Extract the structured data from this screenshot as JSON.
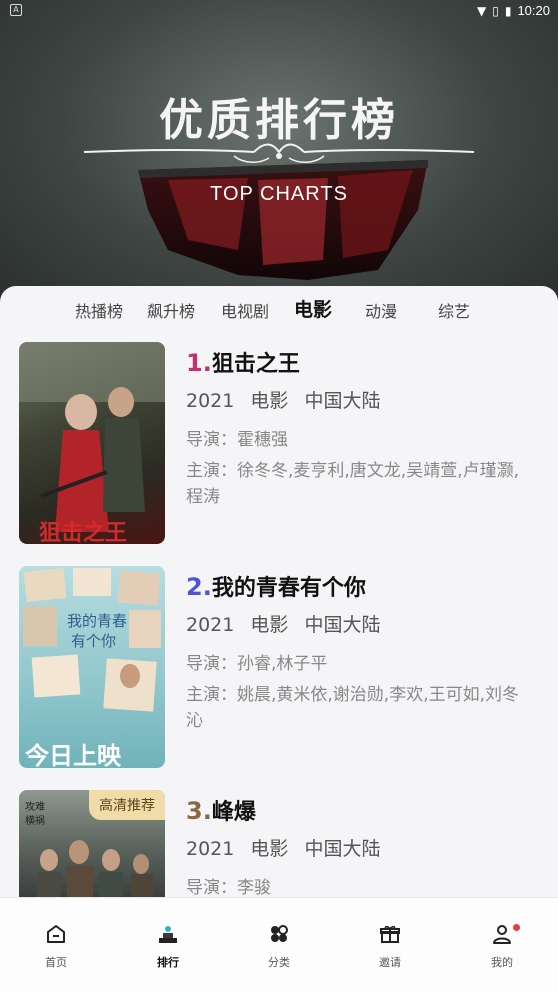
{
  "status_bar": {
    "time": "10:20"
  },
  "hero": {
    "title": "优质排行榜",
    "subtitle": "TOP CHARTS"
  },
  "tabs": [
    {
      "label": "热播榜",
      "active": false
    },
    {
      "label": "飙升榜",
      "active": false
    },
    {
      "label": "电视剧",
      "active": false
    },
    {
      "label": "电影",
      "active": true
    },
    {
      "label": "动漫",
      "active": false
    },
    {
      "label": "综艺",
      "active": false
    }
  ],
  "items": [
    {
      "rank": "1.",
      "rank_color": "#c2336e",
      "title": "狙击之王",
      "year": "2021",
      "type": "电影",
      "region": "中国大陆",
      "director": "导演：霍穗强",
      "cast": "主演：徐冬冬,麦亨利,唐文龙,吴靖萱,卢瑾灏,程涛",
      "poster_text": "狙击之王"
    },
    {
      "rank": "2.",
      "rank_color": "#4b55d6",
      "title": "我的青春有个你",
      "year": "2021",
      "type": "电影",
      "region": "中国大陆",
      "director": "导演：孙睿,林子平",
      "cast": "主演：姚晨,黄米依,谢治勋,李欢,王可如,刘冬沁",
      "poster_text": "今日上映"
    },
    {
      "rank": "3.",
      "rank_color": "#8a6840",
      "title": "峰爆",
      "year": "2021",
      "type": "电影",
      "region": "中国大陆",
      "director": "导演：李骏",
      "badge": "高清推荐"
    }
  ],
  "bottom_nav": [
    {
      "label": "首页",
      "icon": "home-icon",
      "active": false
    },
    {
      "label": "排行",
      "icon": "ranking-icon",
      "active": true
    },
    {
      "label": "分类",
      "icon": "category-icon",
      "active": false
    },
    {
      "label": "邀请",
      "icon": "gift-icon",
      "active": false
    },
    {
      "label": "我的",
      "icon": "profile-icon",
      "active": false,
      "has_dot": true
    }
  ]
}
